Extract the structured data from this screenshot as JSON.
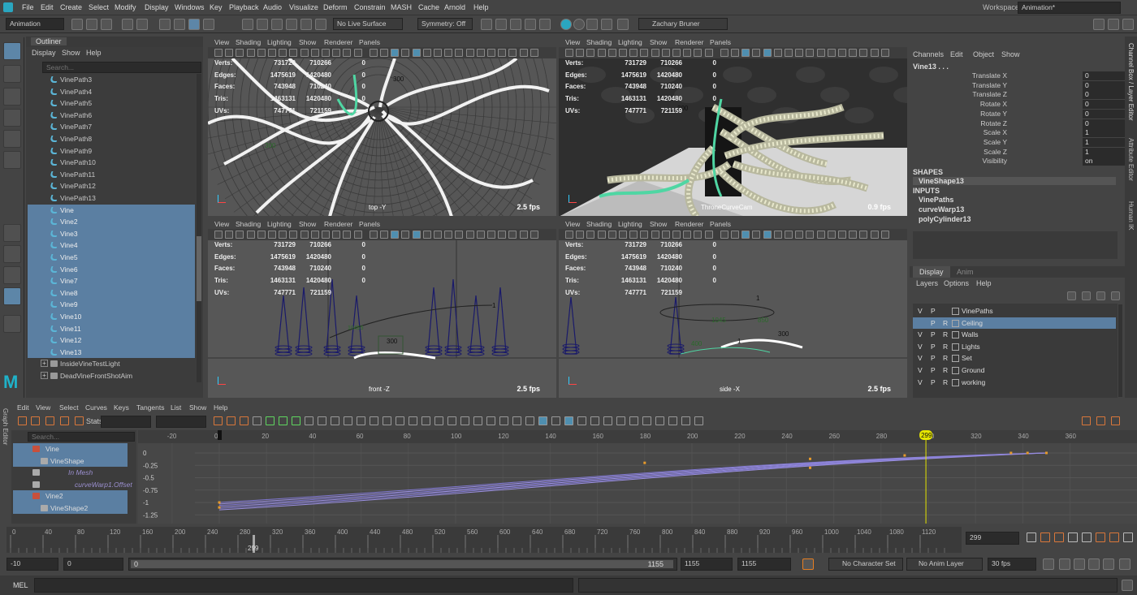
{
  "menubar": [
    "File",
    "Edit",
    "Create",
    "Select",
    "Modify",
    "Display",
    "Windows",
    "Key",
    "Playback",
    "Audio",
    "Visualize",
    "Deform",
    "Constrain",
    "MASH",
    "Cache",
    "Arnold",
    "Help"
  ],
  "workspace": {
    "label": "Workspace:",
    "value": "Animation*"
  },
  "shelf": {
    "mode": "Animation",
    "live_surface": "No Live Surface",
    "symmetry": "Symmetry: Off",
    "user": "Zachary Bruner"
  },
  "outliner": {
    "tab": "Outliner",
    "menu": [
      "Display",
      "Show",
      "Help"
    ],
    "search_placeholder": "Search...",
    "items": [
      {
        "label": "VinePath3",
        "selected": false
      },
      {
        "label": "VinePath4",
        "selected": false
      },
      {
        "label": "VinePath5",
        "selected": false
      },
      {
        "label": "VinePath6",
        "selected": false
      },
      {
        "label": "VinePath7",
        "selected": false
      },
      {
        "label": "VinePath8",
        "selected": false
      },
      {
        "label": "VinePath9",
        "selected": false
      },
      {
        "label": "VinePath10",
        "selected": false
      },
      {
        "label": "VinePath11",
        "selected": false
      },
      {
        "label": "VinePath12",
        "selected": false
      },
      {
        "label": "VinePath13",
        "selected": false
      },
      {
        "label": "Vine",
        "selected": true
      },
      {
        "label": "Vine2",
        "selected": true
      },
      {
        "label": "Vine3",
        "selected": true
      },
      {
        "label": "Vine4",
        "selected": true
      },
      {
        "label": "Vine5",
        "selected": true
      },
      {
        "label": "Vine6",
        "selected": true
      },
      {
        "label": "Vine7",
        "selected": true
      },
      {
        "label": "Vine8",
        "selected": true
      },
      {
        "label": "Vine9",
        "selected": true
      },
      {
        "label": "Vine10",
        "selected": true
      },
      {
        "label": "Vine11",
        "selected": true
      },
      {
        "label": "Vine12",
        "selected": true
      },
      {
        "label": "Vine13",
        "selected": true
      }
    ],
    "groups": [
      "InsideVineTestLight",
      "DeadVineFrontShotAim"
    ]
  },
  "viewport_menu": [
    "View",
    "Shading",
    "Lighting",
    "Show",
    "Renderer",
    "Panels"
  ],
  "stats": {
    "labels": [
      "Verts:",
      "Edges:",
      "Faces:",
      "Tris:",
      "UVs:"
    ],
    "col1": [
      "731729",
      "1475619",
      "743948",
      "1463131",
      "747771"
    ],
    "col2": [
      "710266",
      "1420480",
      "710240",
      "1420480",
      "721159"
    ],
    "col3": [
      "0",
      "0",
      "0",
      "0",
      ""
    ]
  },
  "viewports": [
    {
      "label": "top -Y",
      "fps": "2.5 fps"
    },
    {
      "label": "ThroneCurveCam",
      "fps": "0.9 fps"
    },
    {
      "label": "front -Z",
      "fps": "2.5 fps"
    },
    {
      "label": "side -X",
      "fps": "2.5 fps"
    }
  ],
  "viewport_numbers": {
    "tl_a": "300",
    "tr_a": "300",
    "bl_a": "300",
    "bl_b": "300",
    "br_a": "300",
    "br_b": "1",
    "br_c": "850",
    "br_d": "1045",
    "br_e": "400",
    "bl_c": "1",
    "tl_b": "300",
    "bl_d": "10455"
  },
  "channel_box": {
    "menu": [
      "Channels",
      "Edit",
      "Object",
      "Show"
    ],
    "object": "Vine13 . . .",
    "attrs": [
      {
        "name": "Translate X",
        "value": "0"
      },
      {
        "name": "Translate Y",
        "value": "0"
      },
      {
        "name": "Translate Z",
        "value": "0"
      },
      {
        "name": "Rotate X",
        "value": "0"
      },
      {
        "name": "Rotate Y",
        "value": "0"
      },
      {
        "name": "Rotate Z",
        "value": "0"
      },
      {
        "name": "Scale X",
        "value": "1"
      },
      {
        "name": "Scale Y",
        "value": "1"
      },
      {
        "name": "Scale Z",
        "value": "1"
      },
      {
        "name": "Visibility",
        "value": "on"
      }
    ],
    "shapes_header": "SHAPES",
    "shape": "VineShape13",
    "inputs_header": "INPUTS",
    "inputs": [
      "VinePaths",
      "curveWarp13",
      "polyCylinder13"
    ]
  },
  "layers": {
    "tabs": [
      "Display",
      "Anim"
    ],
    "menu": [
      "Layers",
      "Options",
      "Help"
    ],
    "rows": [
      {
        "v": "V",
        "p": "P",
        "r": "",
        "name": "VinePaths",
        "selected": false
      },
      {
        "v": "",
        "p": "P",
        "r": "R",
        "name": "Ceiling",
        "selected": true
      },
      {
        "v": "V",
        "p": "P",
        "r": "R",
        "name": "Walls",
        "selected": false
      },
      {
        "v": "V",
        "p": "P",
        "r": "R",
        "name": "Lights",
        "selected": false
      },
      {
        "v": "V",
        "p": "P",
        "r": "R",
        "name": "Set",
        "selected": false
      },
      {
        "v": "V",
        "p": "P",
        "r": "R",
        "name": "Ground",
        "selected": false
      },
      {
        "v": "V",
        "p": "P",
        "r": "R",
        "name": "working",
        "selected": false
      }
    ]
  },
  "right_strip": [
    "Channel Box / Layer Editor",
    "Attribute Editor",
    "Human IK"
  ],
  "graph_editor": {
    "title": "Graph Editor",
    "menu": [
      "Edit",
      "View",
      "Select",
      "Curves",
      "Keys",
      "Tangents",
      "List",
      "Show",
      "Help"
    ],
    "stats_label": "Stats",
    "search_placeholder": "Search...",
    "items": [
      {
        "label": "Vine",
        "selected": true
      },
      {
        "label": "VineShape",
        "selected": true
      },
      {
        "label": "In Mesh",
        "selected": false
      },
      {
        "label": "curveWarp1.Offset",
        "selected": false
      },
      {
        "label": "Vine2",
        "selected": true
      },
      {
        "label": "VineShape2",
        "selected": true
      }
    ],
    "x_ticks": [
      "-20",
      "0",
      "20",
      "40",
      "60",
      "80",
      "100",
      "120",
      "140",
      "160",
      "180",
      "200",
      "220",
      "240",
      "260",
      "280",
      "300",
      "320",
      "340",
      "360"
    ],
    "y_ticks": [
      "0",
      "-0.25",
      "-0.5",
      "-0.75",
      "-1",
      "-1.25"
    ],
    "current": "299"
  },
  "timeslider": {
    "ticks": [
      "0",
      "40",
      "80",
      "120",
      "160",
      "200",
      "240",
      "280",
      "320",
      "360",
      "400",
      "440",
      "480",
      "520",
      "560",
      "600",
      "640",
      "680",
      "720",
      "760",
      "800",
      "840",
      "880",
      "920",
      "960",
      "1000",
      "1040",
      "1080",
      "1120"
    ],
    "current": "299",
    "frame_field": "299"
  },
  "range": {
    "start": "-10",
    "anim_start": "0",
    "inner_start": "0",
    "inner_end": "1155",
    "end": "1155",
    "anim_end": "1155",
    "character": "No Character Set",
    "anim_layer": "No Anim Layer",
    "fps": "30 fps"
  },
  "cmd": {
    "label": "MEL"
  }
}
